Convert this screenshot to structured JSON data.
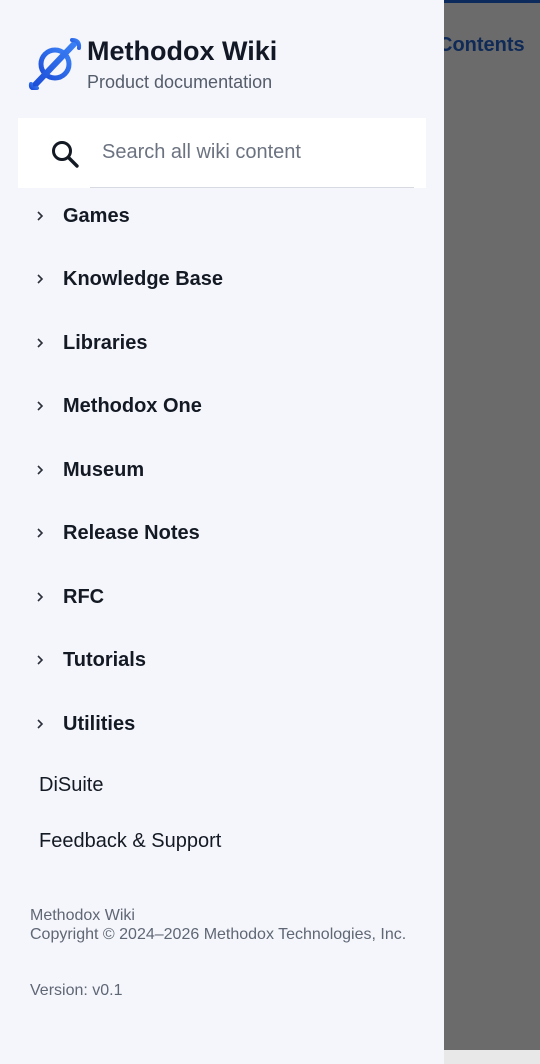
{
  "background": {
    "partial_heading": "Contents"
  },
  "brand": {
    "title": "Methodox Wiki",
    "subtitle": "Product documentation",
    "logo_icon": "planet-ring-logo"
  },
  "search": {
    "placeholder": "Search all wiki content",
    "value": ""
  },
  "nav": {
    "expandable_items": [
      {
        "label": "Games"
      },
      {
        "label": "Knowledge Base"
      },
      {
        "label": "Libraries"
      },
      {
        "label": "Methodox One"
      },
      {
        "label": "Museum"
      },
      {
        "label": "Release Notes"
      },
      {
        "label": "RFC"
      },
      {
        "label": "Tutorials"
      },
      {
        "label": "Utilities"
      }
    ],
    "plain_items": [
      {
        "label": "DiSuite"
      },
      {
        "label": "Feedback & Support"
      }
    ]
  },
  "footer": {
    "site_name": "Methodox Wiki",
    "copyright": "Copyright © 2024–2026 Methodox Technologies, Inc.",
    "version": "Version: v0.1"
  },
  "colors": {
    "drawer_bg": "#f5f6fb",
    "overlay": "#6b6b6b",
    "brand_blue": "#2563eb",
    "text_dark": "#141a24",
    "text_muted": "#5f6775"
  }
}
